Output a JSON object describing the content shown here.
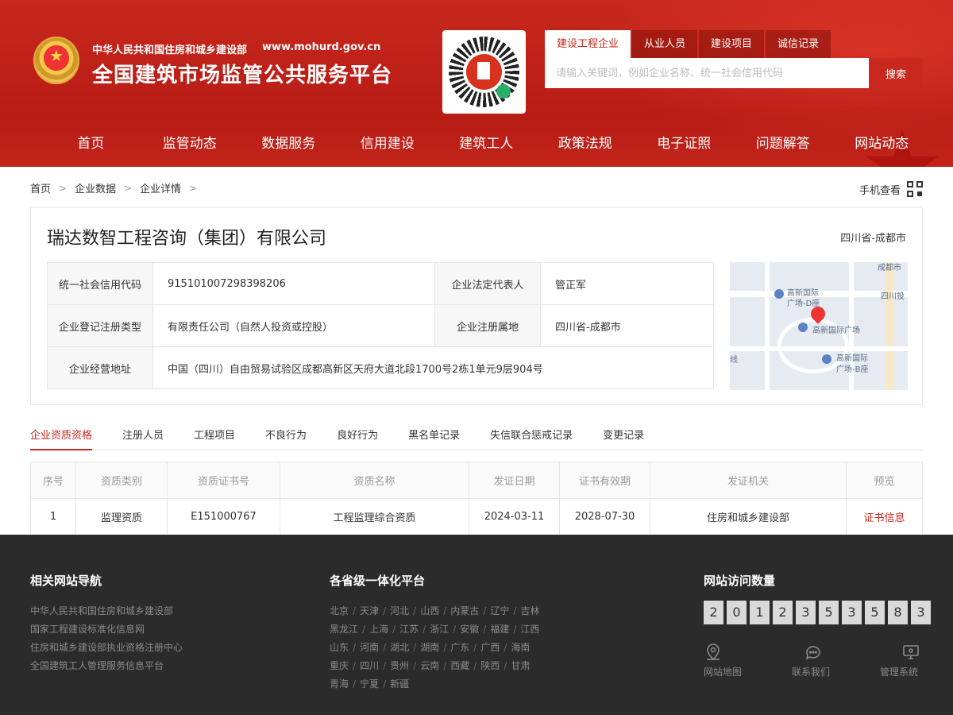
{
  "header": {
    "subtitle": "中华人民共和国住房和城乡建设部",
    "url": "www.mohurd.gov.cn",
    "title": "全国建筑市场监管公共服务平台",
    "search_tabs": [
      "建设工程企业",
      "从业人员",
      "建设项目",
      "诚信记录"
    ],
    "search_placeholder": "请输入关键词，例如企业名称、统一社会信用代码",
    "search_button": "搜索",
    "qr_icon": "mini-program-qr-code"
  },
  "nav": [
    "首页",
    "监管动态",
    "数据服务",
    "信用建设",
    "建筑工人",
    "政策法规",
    "电子证照",
    "问题解答",
    "网站动态"
  ],
  "breadcrumb": [
    "首页",
    "企业数据",
    "企业详情"
  ],
  "mobile_view": "手机查看",
  "company": {
    "name": "瑞达数智工程咨询（集团）有限公司",
    "region": "四川省-成都市",
    "rows": [
      {
        "l1": "统一社会信用代码",
        "v1": "915101007298398206",
        "l2": "企业法定代表人",
        "v2": "管正军"
      },
      {
        "l1": "企业登记注册类型",
        "v1": "有限责任公司（自然人投资或控股）",
        "l2": "企业注册属地",
        "v2": "四川省-成都市"
      },
      {
        "l1": "企业经营地址",
        "v1": "中国（四川）自由贸易试验区成都高新区天府大道北段1700号2栋1单元9层904号"
      }
    ]
  },
  "map": {
    "labels": [
      "成都市",
      "高新国际",
      "广场-D座",
      "四川投",
      "高新国际广场",
      "高新国际",
      "广场-B座",
      "线"
    ]
  },
  "tabs": [
    "企业资质资格",
    "注册人员",
    "工程项目",
    "不良行为",
    "良好行为",
    "黑名单记录",
    "失信联合惩戒记录",
    "变更记录"
  ],
  "qualification": {
    "headers": [
      "序号",
      "资质类别",
      "资质证书号",
      "资质名称",
      "发证日期",
      "证书有效期",
      "发证机关",
      "预览"
    ],
    "rows": [
      [
        "1",
        "监理资质",
        "E151000767",
        "工程监理综合资质",
        "2024-03-11",
        "2028-07-30",
        "住房和城乡建设部",
        "证书信息"
      ]
    ]
  },
  "footer": {
    "nav_title": "相关网站导航",
    "nav_links": [
      "中华人民共和国住房和城乡建设部",
      "国家工程建设标准化信息网",
      "住房和城乡建设部执业资格注册中心",
      "全国建筑工人管理服务信息平台"
    ],
    "prov_title": "各省级一体化平台",
    "provinces": [
      [
        "北京",
        "天津",
        "河北",
        "山西",
        "内蒙古",
        "辽宁",
        "吉林"
      ],
      [
        "黑龙江",
        "上海",
        "江苏",
        "浙江",
        "安徽",
        "福建",
        "江西"
      ],
      [
        "山东",
        "河南",
        "湖北",
        "湖南",
        "广东",
        "广西",
        "海南"
      ],
      [
        "重庆",
        "四川",
        "贵州",
        "云南",
        "西藏",
        "陕西",
        "甘肃"
      ],
      [
        "青海",
        "宁夏",
        "新疆"
      ]
    ],
    "visit_title": "网站访问数量",
    "visit_digits": [
      "2",
      "0",
      "1",
      "2",
      "3",
      "5",
      "3",
      "5",
      "8",
      "3"
    ],
    "icons": [
      {
        "label": "网站地图",
        "icon": "location-pin-icon"
      },
      {
        "label": "联系我们",
        "icon": "chat-bubble-icon"
      },
      {
        "label": "管理系统",
        "icon": "monitor-icon"
      }
    ]
  },
  "colors": {
    "brand_red": "#c8281d",
    "footer_bg": "#2b2b2b"
  }
}
